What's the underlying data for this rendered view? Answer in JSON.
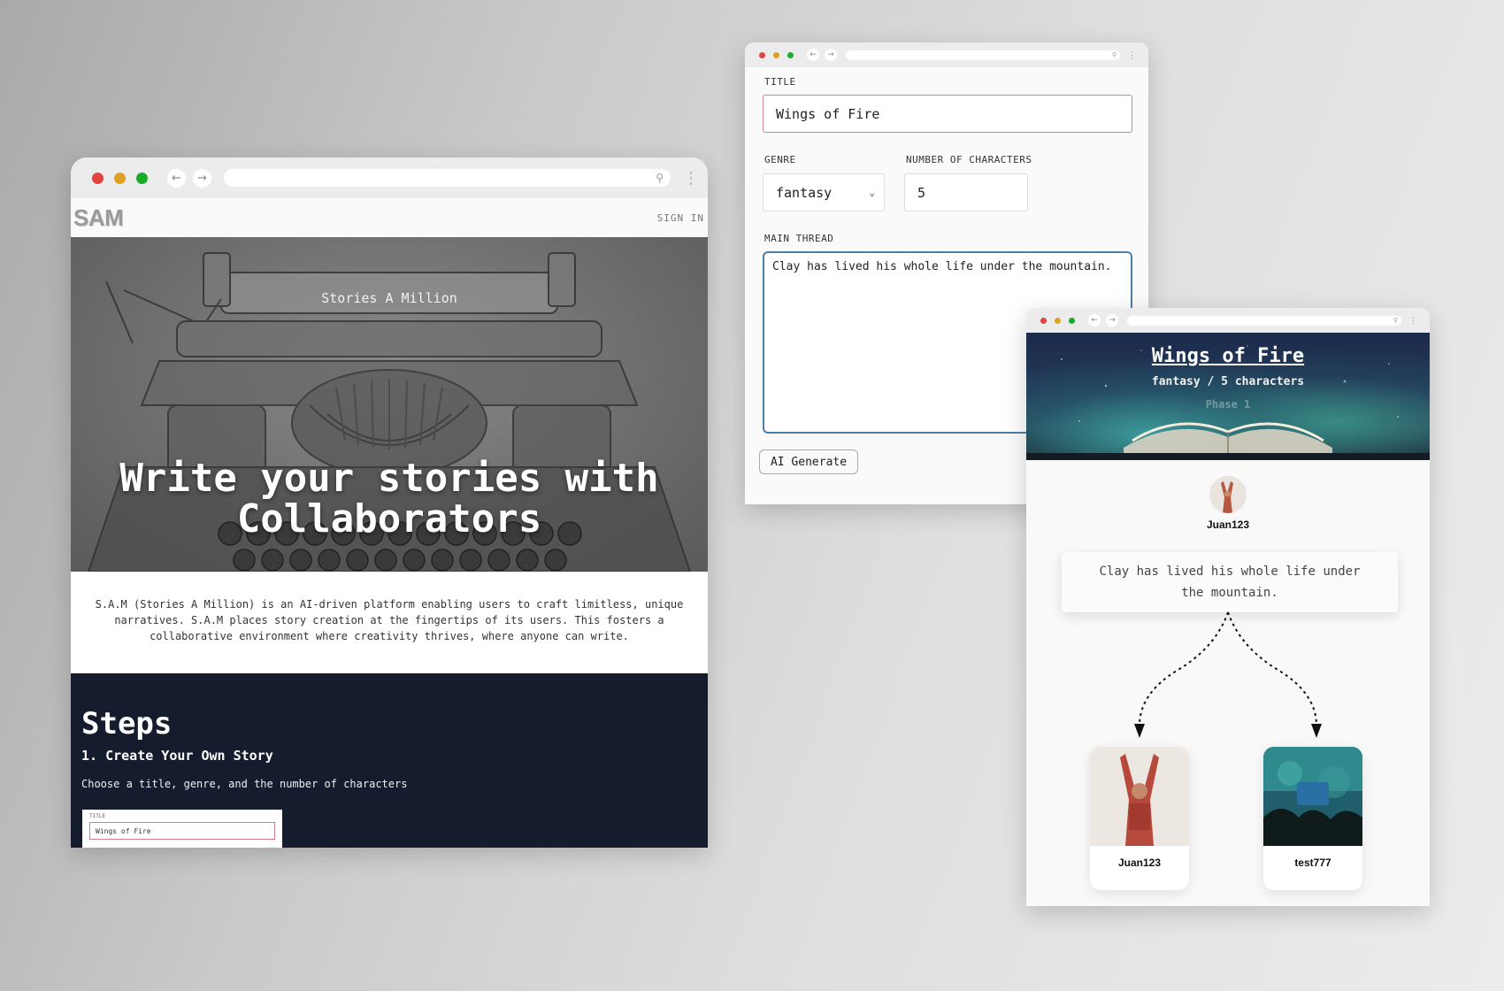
{
  "landing": {
    "logo": "SAM",
    "signin": "SIGN IN",
    "hero_subtitle": "Stories A Million",
    "hero_title": "Write your stories with Collaborators",
    "intro": "S.A.M (Stories A Million) is an AI-driven platform enabling users to craft limitless, unique narratives. S.A.M places story creation at the fingertips of its users. This fosters a collaborative environment where creativity thrives, where anyone can write.",
    "steps_title": "Steps",
    "step1_title": "1. Create Your Own Story",
    "step1_desc": "Choose a title, genre, and the number of characters",
    "mini_form": {
      "label": "TITLE",
      "value": "Wings of Fire"
    }
  },
  "form": {
    "title_label": "TITLE",
    "title_value": "Wings of Fire",
    "genre_label": "GENRE",
    "genre_value": "fantasy",
    "characters_label": "NUMBER OF CHARACTERS",
    "characters_value": "5",
    "thread_label": "MAIN THREAD",
    "thread_value": "Clay has lived his whole life under the mountain.",
    "generate_button": "AI Generate"
  },
  "story": {
    "title": "Wings of Fire",
    "meta": "fantasy / 5 characters",
    "phase": "Phase 1",
    "author": "Juan123",
    "thread_line1": "Clay has lived his whole life under",
    "thread_line2": "the mountain.",
    "children": [
      {
        "name": "Juan123"
      },
      {
        "name": "test777"
      }
    ]
  },
  "icons": {
    "back": "arrow-left-icon",
    "forward": "arrow-right-icon",
    "search": "search-icon",
    "menu": "kebab-menu-icon",
    "dropdown": "chevron-down-icon"
  },
  "colors": {
    "steps_background": "#151c2e",
    "title_border": "#d5868c",
    "thread_border": "#4d7ea8"
  }
}
